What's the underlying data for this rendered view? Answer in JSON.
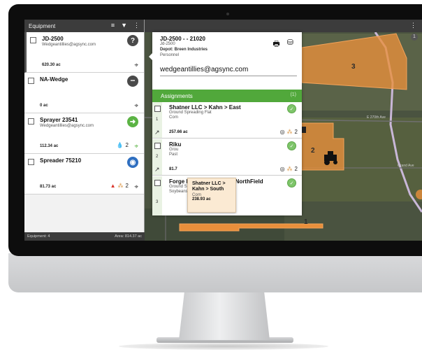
{
  "equipment_panel": {
    "title": "Equipment",
    "items": [
      {
        "name": "JD-2500",
        "email": "Wedgeantillies@agsync.com",
        "acres": "620.30 ac",
        "badge_icon": "help-icon",
        "badge_glyph": "?",
        "badge_color": "#4a4a4a"
      },
      {
        "name": "NA-Wedge",
        "email": "",
        "acres": "0 ac",
        "badge_icon": "more-icon",
        "badge_glyph": "•••",
        "badge_color": "#4a4a4a"
      },
      {
        "name": "Sprayer 23541",
        "email": "Wedgeantillies@agsync.com",
        "acres": "112.34 ac",
        "badge_icon": "arrow-right-icon",
        "badge_glyph": "➜",
        "badge_color": "#5bb344",
        "meta_count": "2"
      },
      {
        "name": "Spreader 75210",
        "email": "",
        "acres": "81.73 ac",
        "badge_icon": "spreader-icon",
        "badge_glyph": "◉",
        "badge_color": "#2f6fc0",
        "meta_count": "2"
      }
    ],
    "footer": {
      "count_label": "Equipment: 4",
      "area_label": "Area: 814.37 ac"
    }
  },
  "detail": {
    "title": "JD-2500 - - 21020",
    "model": "Jd-2500",
    "depot": "Depot: Breen Industries",
    "category": "Personnel",
    "email": "wedgeantillies@agsync.com",
    "assignments_label": "Assignments",
    "assignments_badge": "(1)",
    "assignments": [
      {
        "number": "1",
        "name": "Shatner LLC > Kahn > East",
        "operation": "Ground Spreading Flat",
        "crop": "Corn",
        "acres": "257.66 ac",
        "meta_count": "2"
      },
      {
        "number": "2",
        "name": "Riku",
        "operation": "Grou",
        "crop": "Past",
        "acres": "81.7",
        "meta_count": "2"
      },
      {
        "number": "3",
        "name": "Forge Farm > Williams > NorthField",
        "operation": "Ground Spreading Flat",
        "crop": "Soybeans"
      }
    ]
  },
  "tooltip": {
    "name": "Shatner LLC > Kahn > South",
    "crop": "Corn",
    "acres": "238.93 ac"
  },
  "map": {
    "field_labels": [
      "3",
      "2",
      "1"
    ],
    "road_labels": [
      "E 270th Ave",
      "Grand Ave"
    ],
    "zoom_label": "1"
  },
  "colors": {
    "accent_green": "#51a83b",
    "field_orange": "#e98f3b",
    "header_dark": "#3c3c3c"
  }
}
